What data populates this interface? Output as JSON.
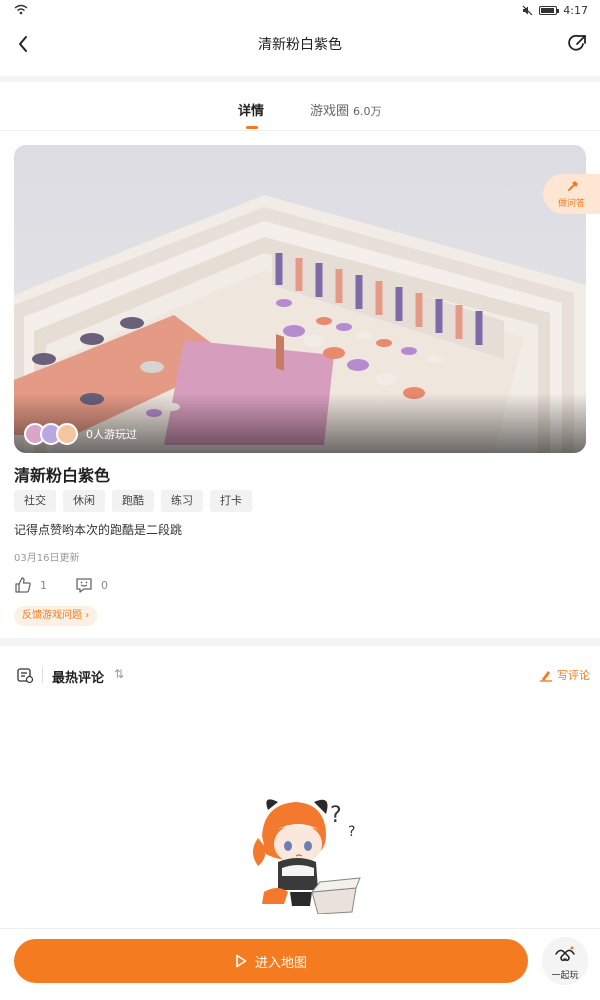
{
  "status_bar": {
    "time": "4:17"
  },
  "header": {
    "title": "清新粉白紫色"
  },
  "tabs": [
    {
      "label": "详情",
      "active": true
    },
    {
      "label": "游戏圈",
      "count": "6.0万"
    }
  ],
  "banner": {
    "played_text": "0人游玩过",
    "faq_label": "做问答"
  },
  "game": {
    "title": "清新粉白紫色",
    "tags": [
      "社交",
      "休闲",
      "跑酷",
      "练习",
      "打卡"
    ],
    "description": "记得点赞哟本次的跑酷是二段跳",
    "updated": "03月16日更新",
    "likes": "1",
    "comments": "0",
    "feedback_label": "反馈游戏问题"
  },
  "comments": {
    "title": "最热评论",
    "sort_icon": "sort-icon",
    "write_label": "写评论"
  },
  "bottom": {
    "enter_label": "进入地图",
    "coplay_label": "一起玩"
  },
  "colors": {
    "accent": "#f47b20",
    "accent_light": "#fde6d4"
  }
}
